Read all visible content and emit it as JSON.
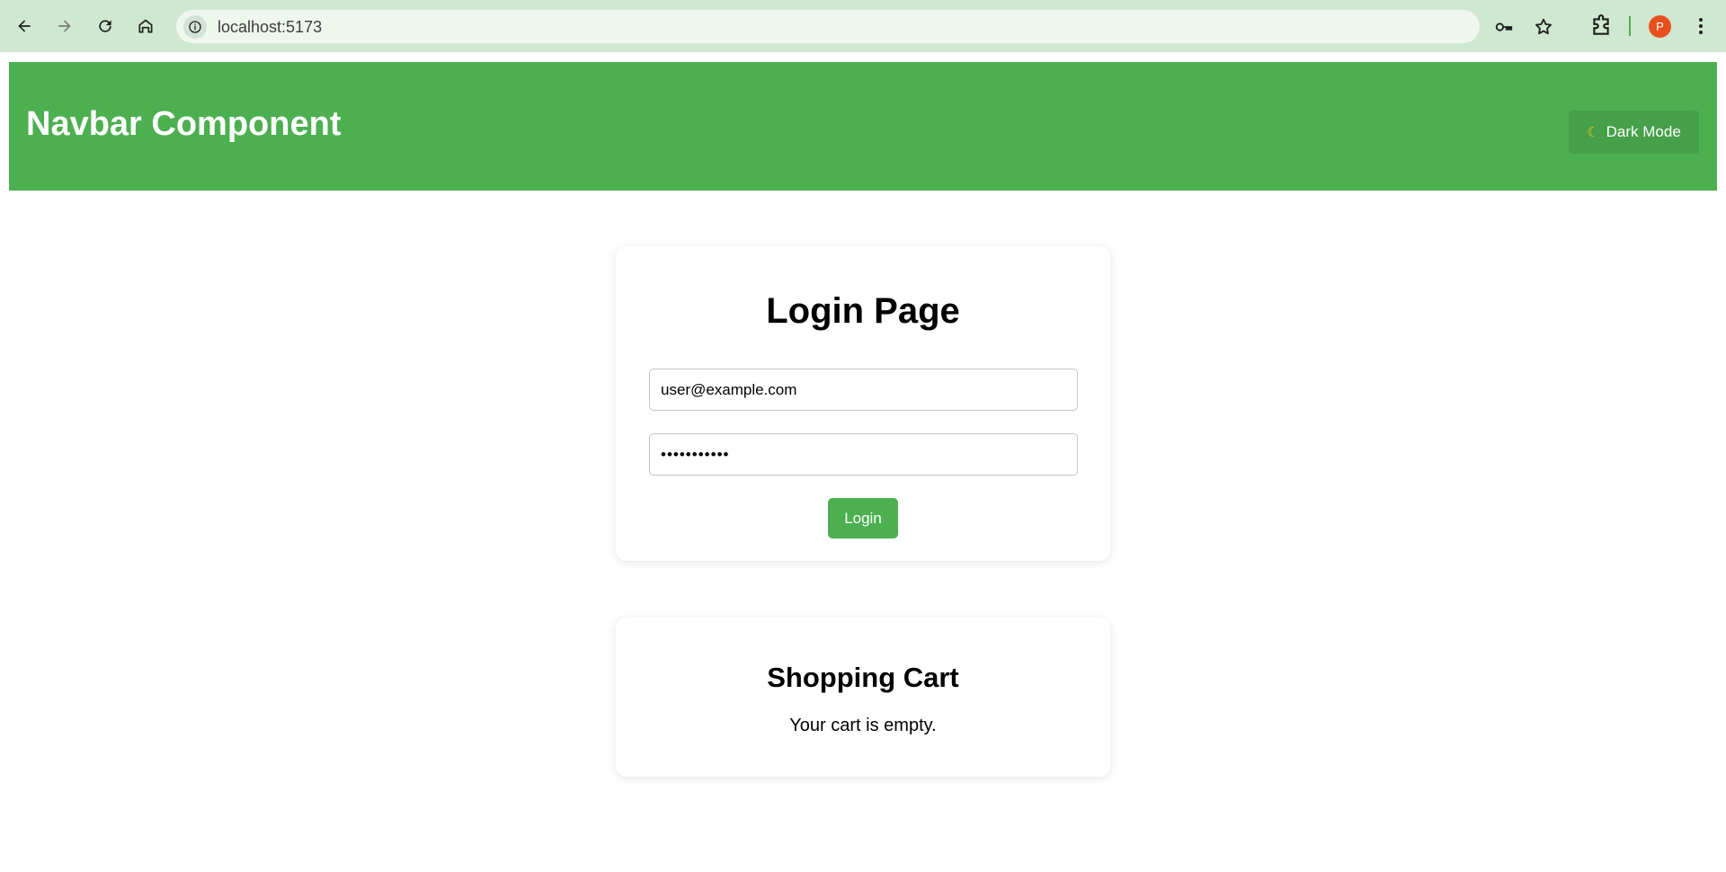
{
  "browser": {
    "url": "localhost:5173",
    "avatar_initial": "P"
  },
  "navbar": {
    "title": "Navbar Component",
    "dark_mode_label": "Dark Mode",
    "background_color": "#4caf50"
  },
  "login": {
    "title": "Login Page",
    "email_value": "user@example.com",
    "password_value": "•••••••••••",
    "button_label": "Login"
  },
  "cart": {
    "title": "Shopping Cart",
    "empty_message": "Your cart is empty."
  }
}
